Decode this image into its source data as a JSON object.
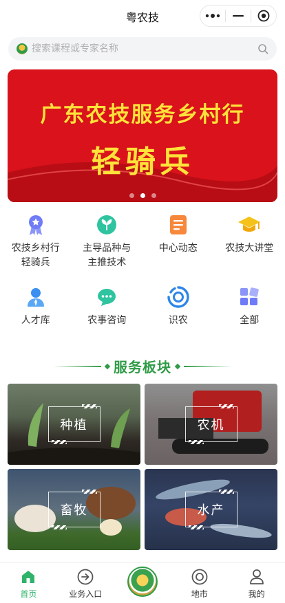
{
  "app": {
    "title": "粤农技"
  },
  "search": {
    "placeholder": "搜索课程或专家名称"
  },
  "banner": {
    "line1": "广东农技服务乡村行",
    "line2": "轻骑兵",
    "dots": 3,
    "active_dot": 2
  },
  "grid": [
    {
      "label": "农技乡村行\n轻骑兵",
      "icon": "medal-icon",
      "color": "#6f7bf7"
    },
    {
      "label": "主导品种与\n主推技术",
      "icon": "sprout-icon",
      "color": "#2fc4a0"
    },
    {
      "label": "中心动态",
      "icon": "news-list-icon",
      "color": "#f7873b"
    },
    {
      "label": "农技大讲堂",
      "icon": "graduation-cap-icon",
      "color": "#f5c21b"
    },
    {
      "label": "人才库",
      "icon": "person-icon",
      "color": "#3a8ff0"
    },
    {
      "label": "农事咨询",
      "icon": "chat-bubble-icon",
      "color": "#2fc4a0"
    },
    {
      "label": "识农",
      "icon": "scan-eye-icon",
      "color": "#2d86e8"
    },
    {
      "label": "全部",
      "icon": "apps-grid-icon",
      "color": "#6f7bf7"
    }
  ],
  "section": {
    "title": "服务板块"
  },
  "cards": [
    {
      "label": "种植",
      "icon": "planting-photo"
    },
    {
      "label": "农机",
      "icon": "machinery-photo"
    },
    {
      "label": "畜牧",
      "icon": "livestock-photo"
    },
    {
      "label": "水产",
      "icon": "aquatic-photo"
    }
  ],
  "tabbar": {
    "items": [
      {
        "label": "首页",
        "icon": "home-icon",
        "active": true
      },
      {
        "label": "业务入口",
        "icon": "arrow-circle-icon",
        "active": false
      },
      {
        "label": "",
        "icon": "app-logo-icon",
        "active": false
      },
      {
        "label": "地市",
        "icon": "location-ring-icon",
        "active": false
      },
      {
        "label": "我的",
        "icon": "user-icon",
        "active": false
      }
    ]
  },
  "colors": {
    "brand_green": "#2f9b46",
    "tab_active": "#2fb36b",
    "banner_red": "#d9121b",
    "banner_text": "#ffe23a"
  }
}
